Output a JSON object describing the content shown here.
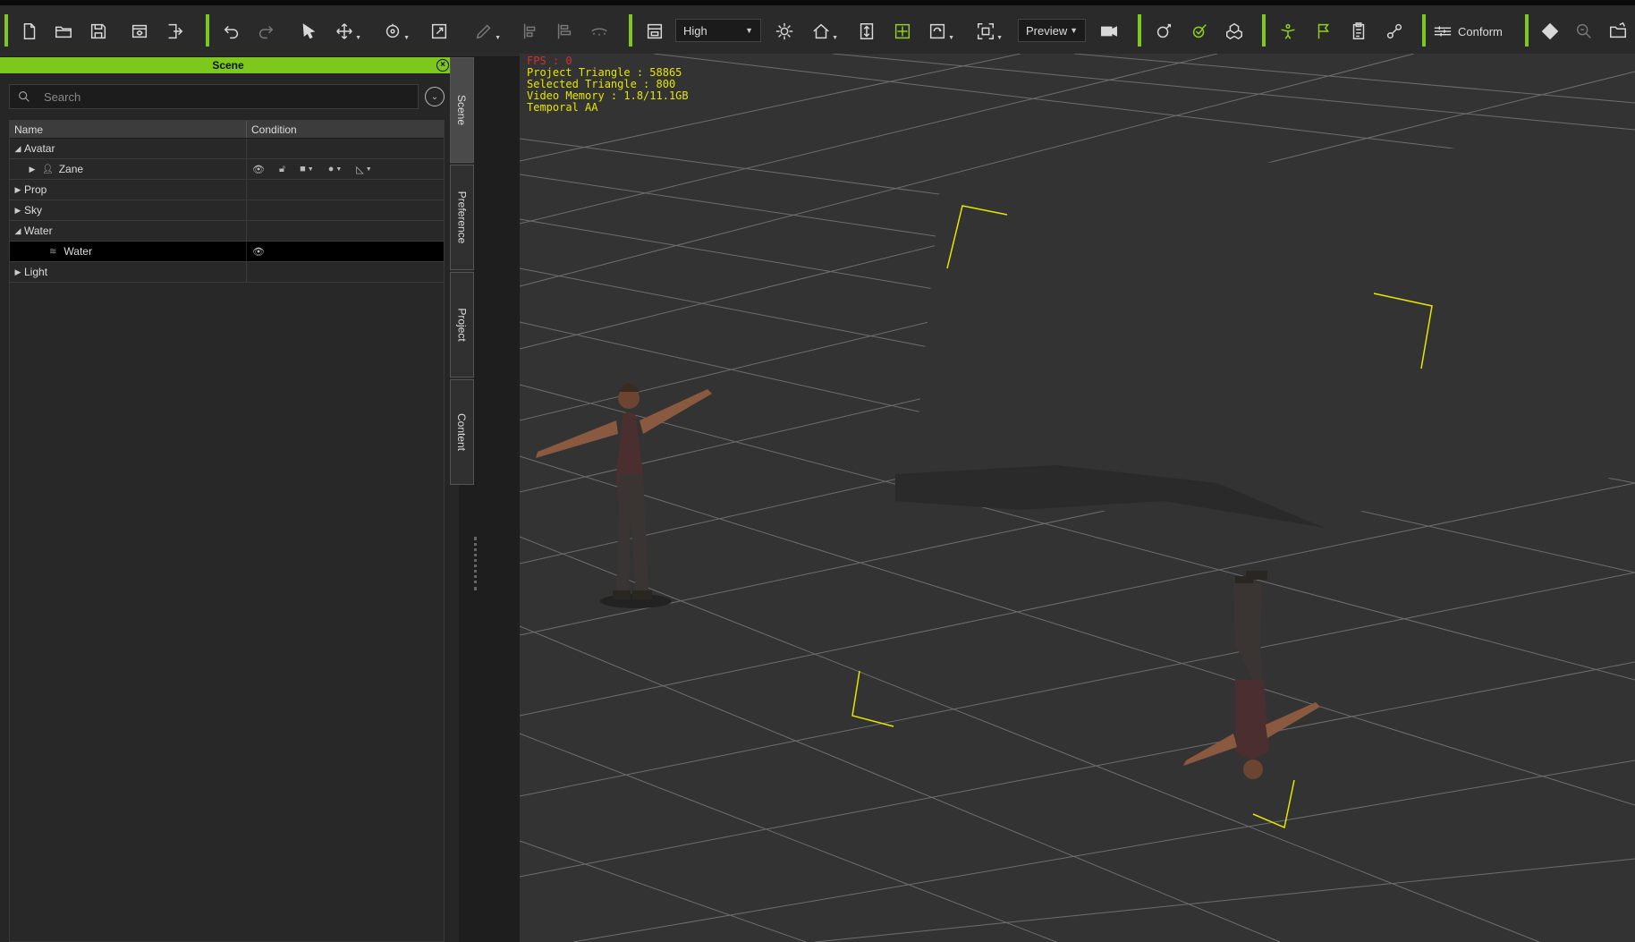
{
  "toolbar": {
    "quality_value": "High",
    "preview_value": "Preview",
    "conform_label": "Conform"
  },
  "scene_panel": {
    "title": "Scene",
    "search_placeholder": "Search",
    "columns": {
      "name": "Name",
      "condition": "Condition"
    },
    "rows": [
      {
        "label": "Avatar",
        "expanded": true
      },
      {
        "label": "Zane",
        "expanded": false
      },
      {
        "label": "Prop",
        "expanded": false
      },
      {
        "label": "Sky",
        "expanded": false
      },
      {
        "label": "Water",
        "expanded": true
      },
      {
        "label": "Water",
        "selected": true
      },
      {
        "label": "Light",
        "expanded": false
      }
    ]
  },
  "side_tabs": [
    "Scene",
    "Preference",
    "Project",
    "Content"
  ],
  "viewport": {
    "stats": {
      "fps": "FPS : 0",
      "project_triangle": "Project Triangle : 58865",
      "selected_triangle": "Selected Triangle : 800",
      "video_memory": "Video Memory : 1.8/11.1GB",
      "aa": "Temporal AA"
    }
  },
  "colors": {
    "accent": "#7ec81e",
    "stats_red": "#d03030",
    "stats_yellow": "#e6e600",
    "selection": "#e6e600"
  }
}
